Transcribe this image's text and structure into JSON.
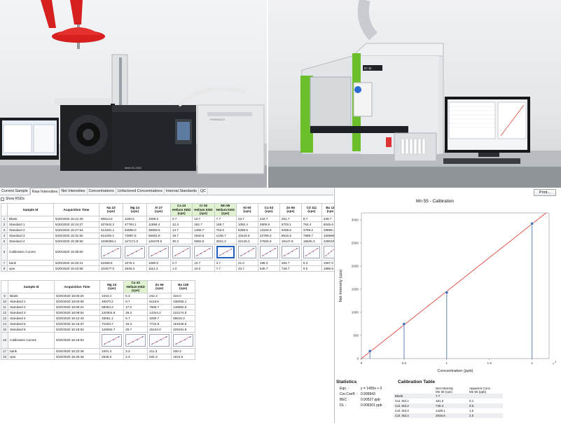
{
  "tabs": [
    {
      "label": "Current Sample",
      "active": false
    },
    {
      "label": "Raw Intensities",
      "active": true
    },
    {
      "label": "Net Intensities",
      "active": false
    },
    {
      "label": "Concentrations",
      "active": false
    },
    {
      "label": "Unfactored Concentrations",
      "active": false
    },
    {
      "label": "Internal Standards",
      "active": false
    },
    {
      "label": "QC",
      "active": false
    }
  ],
  "show_rsds_label": "Show RSDs",
  "photos": {
    "gc_brand": "SHIMADZU",
    "gc_model": "Nexis GC-2030",
    "icp_badge": "IC-11",
    "colors": {
      "hood": "#d61f1f",
      "instrument_green": "#6bbf2a",
      "instrument_body": "#dfe3e6"
    }
  },
  "table1": {
    "headers": [
      "",
      "Sample Id",
      "Acquisition Time",
      "Na 23\n(cps)",
      "Mg 24\n(cps)",
      "Al 27\n(cps)",
      "Ca 43\nHelium KED\n(cps)",
      "Cr 52\nHelium KED\n(cps)",
      "Mn 55\nHelium KED\n(cps)",
      "Ni 60\n(cps)",
      "Cu 63\n(cps)",
      "Zn 66\n(cps)",
      "Cd 111\n(cps)",
      "Ba 13\n(cps"
    ],
    "green_columns": [
      6,
      7,
      8
    ],
    "rows": [
      [
        "1",
        "Blank",
        "5/20/2020 15:21:30",
        "55513.0",
        "1100.0",
        "1059.0",
        "0.7",
        "10.7",
        "7.7",
        "23.7",
        "242.7",
        "261.7",
        "8.7",
        "349.7"
      ],
      [
        "2",
        "Standard 1",
        "5/20/2020 15:24:27",
        "207642.2",
        "47793.1",
        "11658.4",
        "12.3",
        "262.7",
        "168.7",
        "1092.4",
        "2809.9",
        "5703.1",
        "754.4",
        "6045.6"
      ],
      [
        "3",
        "Standard 2",
        "5/20/2020 15:27:54",
        "414291.1",
        "94666.0",
        "36609.5",
        "14.7",
        "1495.7",
        "753.0",
        "5289.6",
        "12328.3",
        "9409.6",
        "3789.2",
        "29598.3"
      ],
      [
        "4",
        "Standard 3",
        "5/20/2020 15:31:50",
        "611029.4",
        "72887.5",
        "65931.8",
        "19.7",
        "2940.6",
        "1436.7",
        "10444.5",
        "22799.2",
        "8515.5",
        "7689.7",
        "150690.1"
      ],
      [
        "5",
        "Standard 4",
        "5/20/2020 15:35:50",
        "1039306.1",
        "127171.0",
        "126478.5",
        "30.3",
        "6082.6",
        "2924.3",
        "22145.2",
        "47825.6",
        "16147.8",
        "16536.3",
        "228010.8"
      ],
      [
        "6",
        "Calibration Curves",
        "5/20/2020 15:35:50",
        "",
        "",
        "",
        "",
        "",
        "",
        "",
        "",
        "",
        "",
        ""
      ],
      [
        "7",
        "bank",
        "5/20/2020 15:40:21",
        "53458.8",
        "1578.4",
        "1080.0",
        "0.7",
        "10.7",
        "3.7",
        "21.0",
        "186.3",
        "253.7",
        "6.3",
        "1557.0"
      ],
      [
        "8",
        "vpw",
        "5/20/2020 15:43:58",
        "102577.0",
        "2846.3",
        "1112.3",
        "1.0",
        "10.0",
        "7.7",
        "43.7",
        "545.7",
        "729.7",
        "9.0",
        "1985.8"
      ]
    ]
  },
  "table2": {
    "headers": [
      "",
      "Sample Id",
      "Acquisition Time",
      "Mg 24\n(cps)",
      "Ca 43\nHelium KED\n(cps)",
      "Zn 66\n(cps)",
      "Ba 138\n(cps)"
    ],
    "green_columns": [
      4
    ],
    "rows": [
      [
        "9",
        "Blank",
        "5/20/2020 16:00:20",
        "1044.4",
        "0.3",
        "242.3",
        "319.0"
      ],
      [
        "10",
        "Standard 1",
        "5/20/2020 16:03:08",
        "40570.2",
        "9.7",
        "5118.9",
        "238255.1"
      ],
      [
        "11",
        "Standard 2",
        "5/20/2020 16:06:21",
        "68304.3",
        "17.0",
        "7686.7",
        "146682.9"
      ],
      [
        "12",
        "Standard 3",
        "5/20/2020 16:09:04",
        "120304.9",
        "28.3",
        "14344.2",
        "222174.5"
      ],
      [
        "13",
        "Standard 4",
        "5/20/2020 16:12:43",
        "45051.1",
        "6.7",
        "4290.7",
        "55615.3"
      ],
      [
        "14",
        "Standard 5",
        "5/20/2020 16:15:37",
        "71033.7",
        "15.3",
        "7724.8",
        "151046.5"
      ],
      [
        "15",
        "Standard 6",
        "5/20/2020 16:18:53",
        "129062.7",
        "29.7",
        "15134.0",
        "229191.8"
      ],
      [
        "16",
        "Calibration Curves",
        "5/20/2020 16:18:53",
        "",
        "",
        "",
        ""
      ],
      [
        "17",
        "bank",
        "5/20/2020 16:22:48",
        "1001.4",
        "3.3",
        "211.3",
        "330.3"
      ],
      [
        "18",
        "vpw",
        "5/20/2020 16:26:48",
        "2549.6",
        "2.3",
        "631.3",
        "1810.6"
      ]
    ]
  },
  "print_label": "Print...",
  "chart_title": "Mn 55   -   Calibration",
  "chart_data": {
    "type": "scatter",
    "title": "Mn 55   -   Calibration",
    "xlabel": "Concentration (ppb)",
    "ylabel": "Net Intensity (cps)",
    "x_ticks": [
      "0",
      "0.5",
      "1",
      "1.5",
      "2"
    ],
    "y_ticks": [
      "0",
      "500",
      "1000",
      "1500",
      "2000",
      "2500",
      "3000"
    ],
    "xlim": [
      0,
      2.2
    ],
    "ylim": [
      0,
      3150
    ],
    "points": [
      {
        "x": 0.1,
        "y": 161.0
      },
      {
        "x": 0.5,
        "y": 745.4
      },
      {
        "x": 1.0,
        "y": 1429.1
      },
      {
        "x": 2.0,
        "y": 2916.6
      }
    ],
    "fit": {
      "slope": 1455,
      "intercept": 0
    },
    "grid": false,
    "colors": {
      "fit_line": "#e0443a",
      "points": "#3b6fb6",
      "stems": "#6f8fb5"
    }
  },
  "statistics": {
    "title": "Statistics",
    "rows": [
      {
        "label": "Eqn. :",
        "value": "y = 1455x + 0"
      },
      {
        "label": "Cor.Coeff. :",
        "value": "0.999943"
      },
      {
        "label": "BEC :",
        "value": "0.00527   ppb"
      },
      {
        "label": "DL :",
        "value": "0.006301   ppb"
      }
    ]
  },
  "calibration_table": {
    "title": "Calibration Table",
    "headers": [
      "",
      "Net Intensity\nMn 55 (cps)",
      "Apparent Conc.\nMn 55 (ppb)"
    ],
    "rows": [
      [
        "Blank",
        "7.7",
        ""
      ],
      [
        "Cal. Std.1",
        "161.0",
        "0.1"
      ],
      [
        "Cal. Std.2",
        "745.4",
        "0.5"
      ],
      [
        "Cal. Std.3",
        "1429.1",
        "1.0"
      ],
      [
        "Cal. Std.4",
        "2916.6",
        "2.0"
      ]
    ]
  }
}
